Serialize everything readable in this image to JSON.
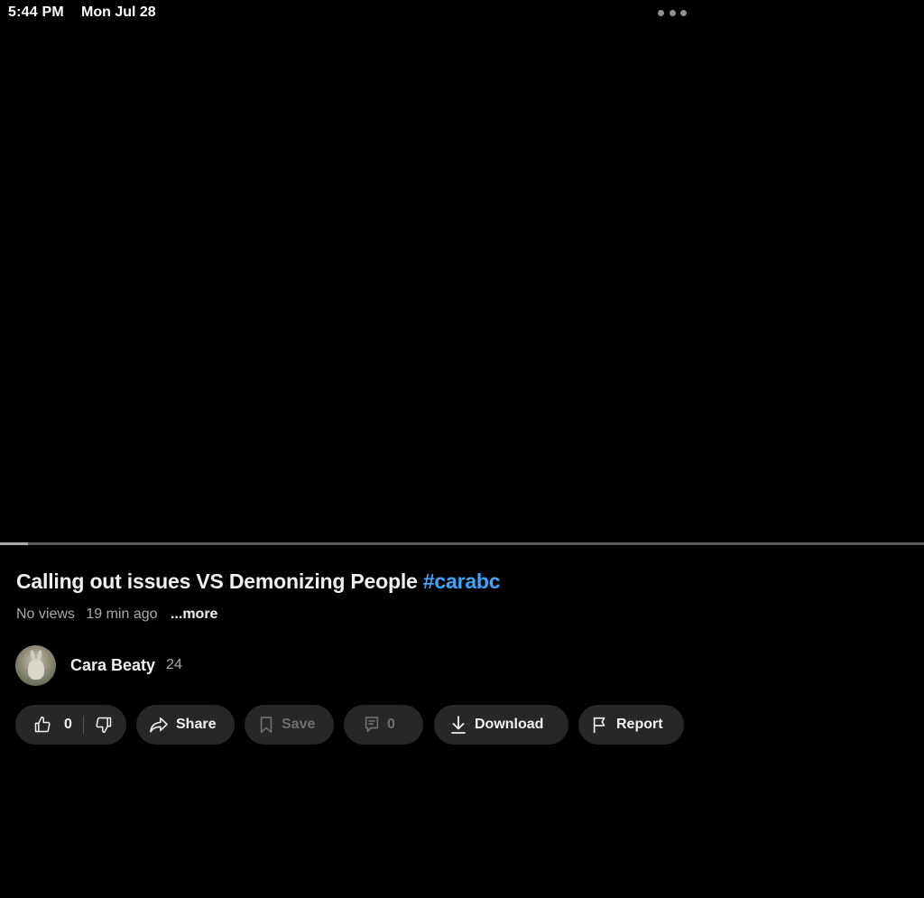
{
  "status_bar": {
    "time": "5:44 PM",
    "date": "Mon Jul 28",
    "multitask_icon": "ellipsis-dots-icon"
  },
  "video": {
    "progress_fraction": 0.03,
    "title": "Calling out issues VS Demonizing People",
    "hashtag": "#carabc",
    "views": "No views",
    "age": "19 min ago",
    "more_label": "...more"
  },
  "channel": {
    "name": "Cara Beaty",
    "subscribers": "24",
    "avatar_icon": "rabbit-avatar"
  },
  "actions": {
    "like_count": "0",
    "share_label": "Share",
    "save_label": "Save",
    "comment_count": "0",
    "download_label": "Download",
    "report_label": "Report"
  },
  "colors": {
    "background": "#000000",
    "pill": "#272727",
    "hashtag": "#3ea6ff",
    "secondary_text": "#aaaaaa"
  }
}
